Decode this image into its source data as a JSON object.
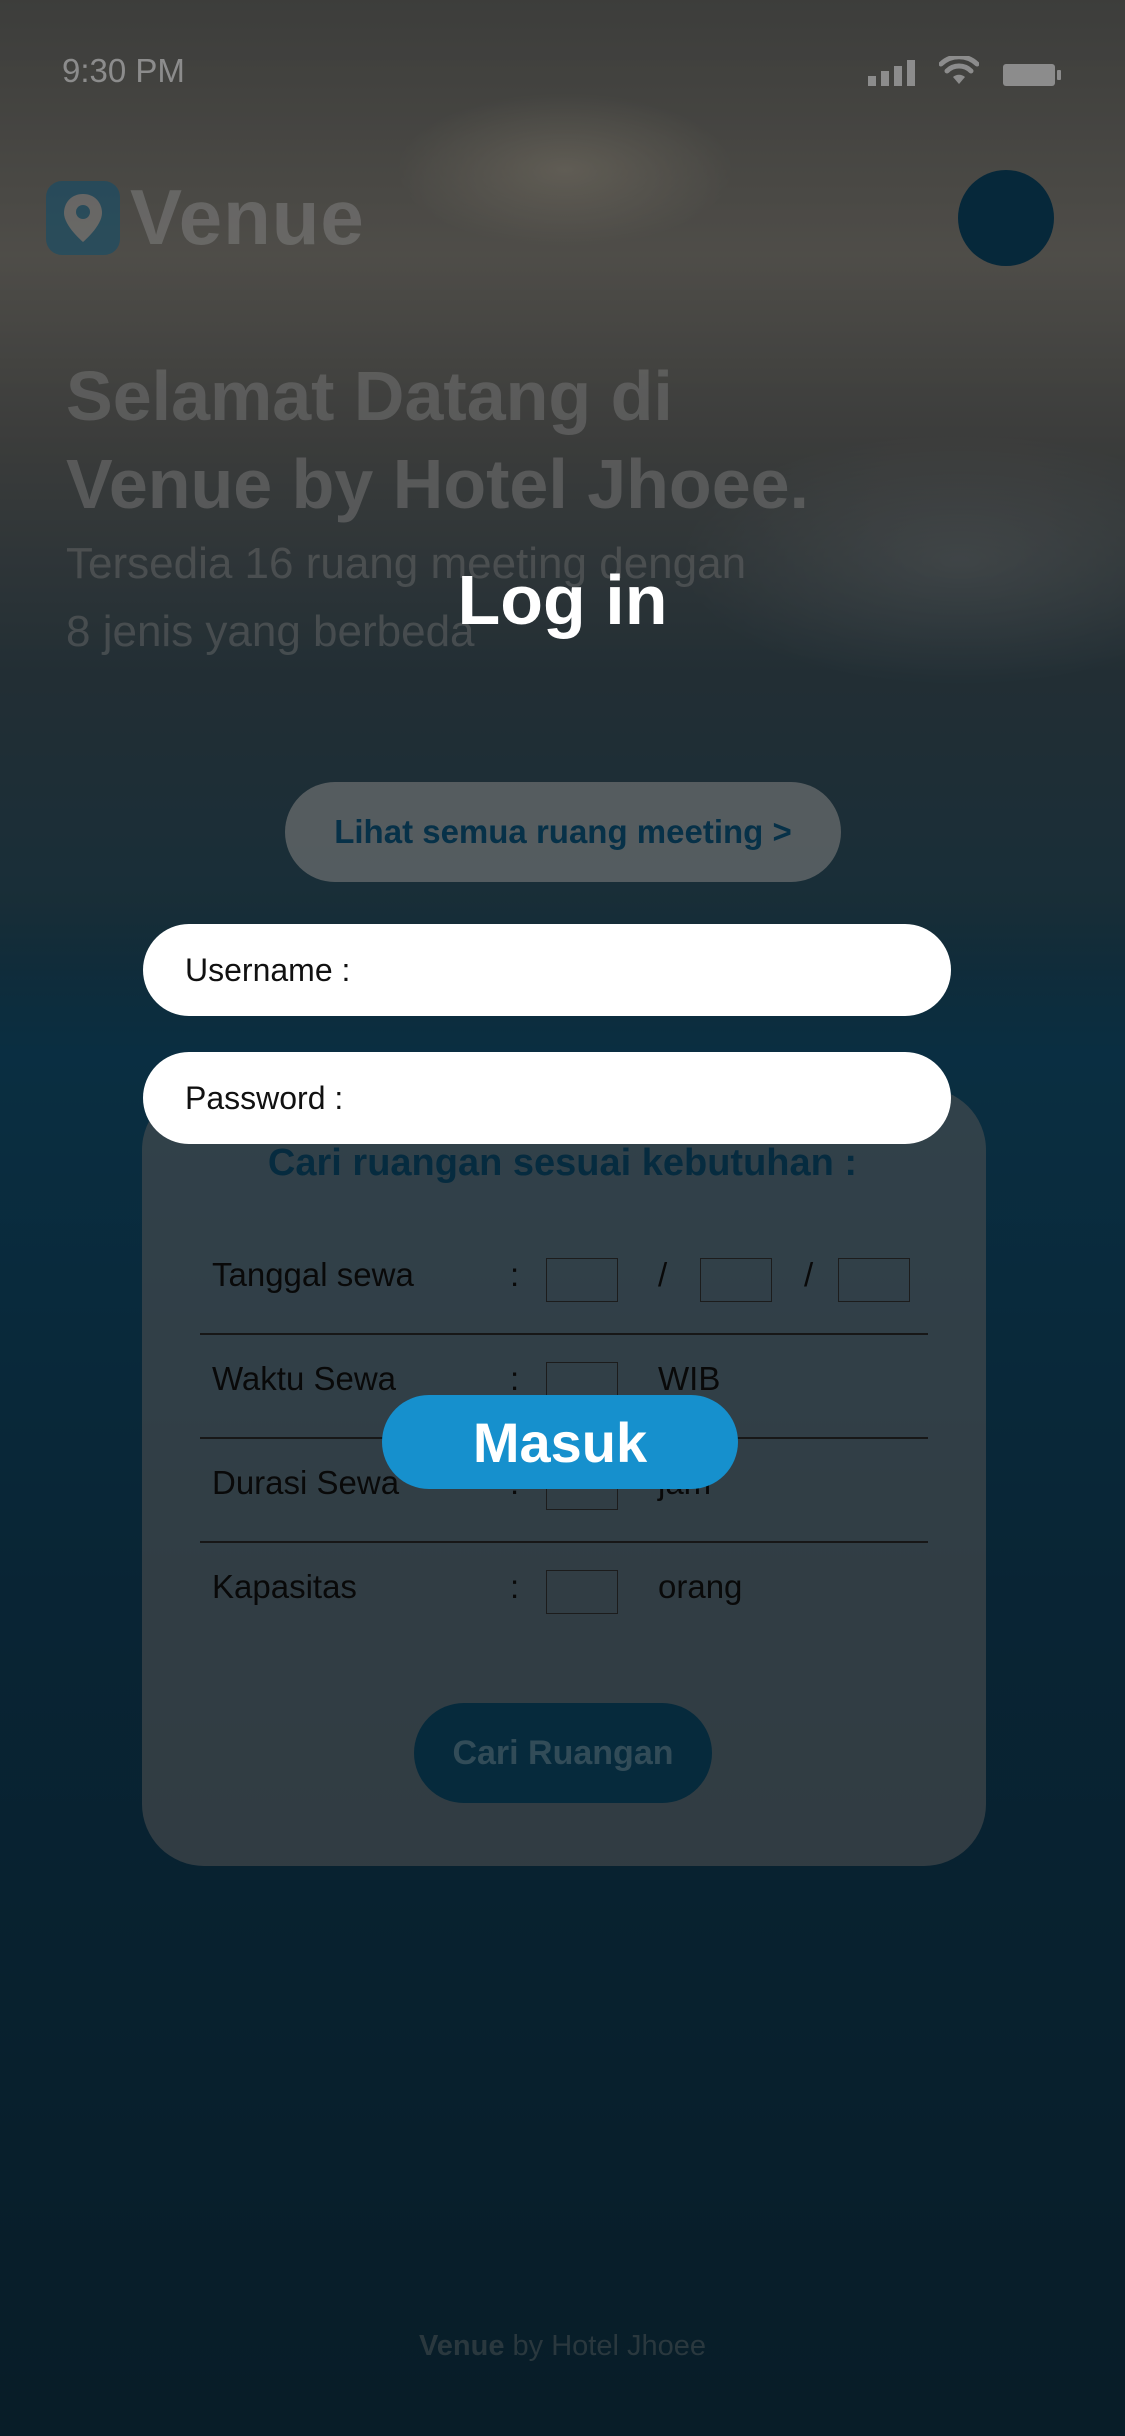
{
  "status_bar": {
    "time": "9:30 PM",
    "signal_icon": "cellular-signal-icon",
    "wifi_icon": "wifi-icon",
    "battery_icon": "battery-icon"
  },
  "header": {
    "logo_text": "Venue",
    "logo_icon": "location-pin-icon"
  },
  "hero": {
    "title_line1": "Selamat Datang di",
    "title_line2": "Venue by Hotel Jhoee.",
    "subtitle_line1": "Tersedia 16 ruang meeting dengan",
    "subtitle_line2": "8 jenis yang berbeda"
  },
  "login": {
    "title": "Log in",
    "username_label": "Username :",
    "password_label": "Password :",
    "submit_label": "Masuk"
  },
  "all_rooms_button": "Lihat semua ruang meeting >",
  "search": {
    "title": "Cari ruangan sesuai kebutuhan :",
    "rows": [
      {
        "label": "Tanggal sewa",
        "colon": ":",
        "date_sep": "/"
      },
      {
        "label": "Waktu Sewa",
        "colon": ":",
        "unit": "WIB"
      },
      {
        "label": "Durasi Sewa",
        "colon": ":",
        "unit": "jam"
      },
      {
        "label": "Kapasitas",
        "colon": ":",
        "unit": "orang"
      }
    ],
    "button_label": "Cari Ruangan"
  },
  "footer": {
    "brand": "Venue",
    "suffix": " by Hotel Jhoee"
  },
  "colors": {
    "accent_blue": "#1690cd",
    "dark_blue": "#0b4d6e",
    "background": "#0f3a50"
  }
}
